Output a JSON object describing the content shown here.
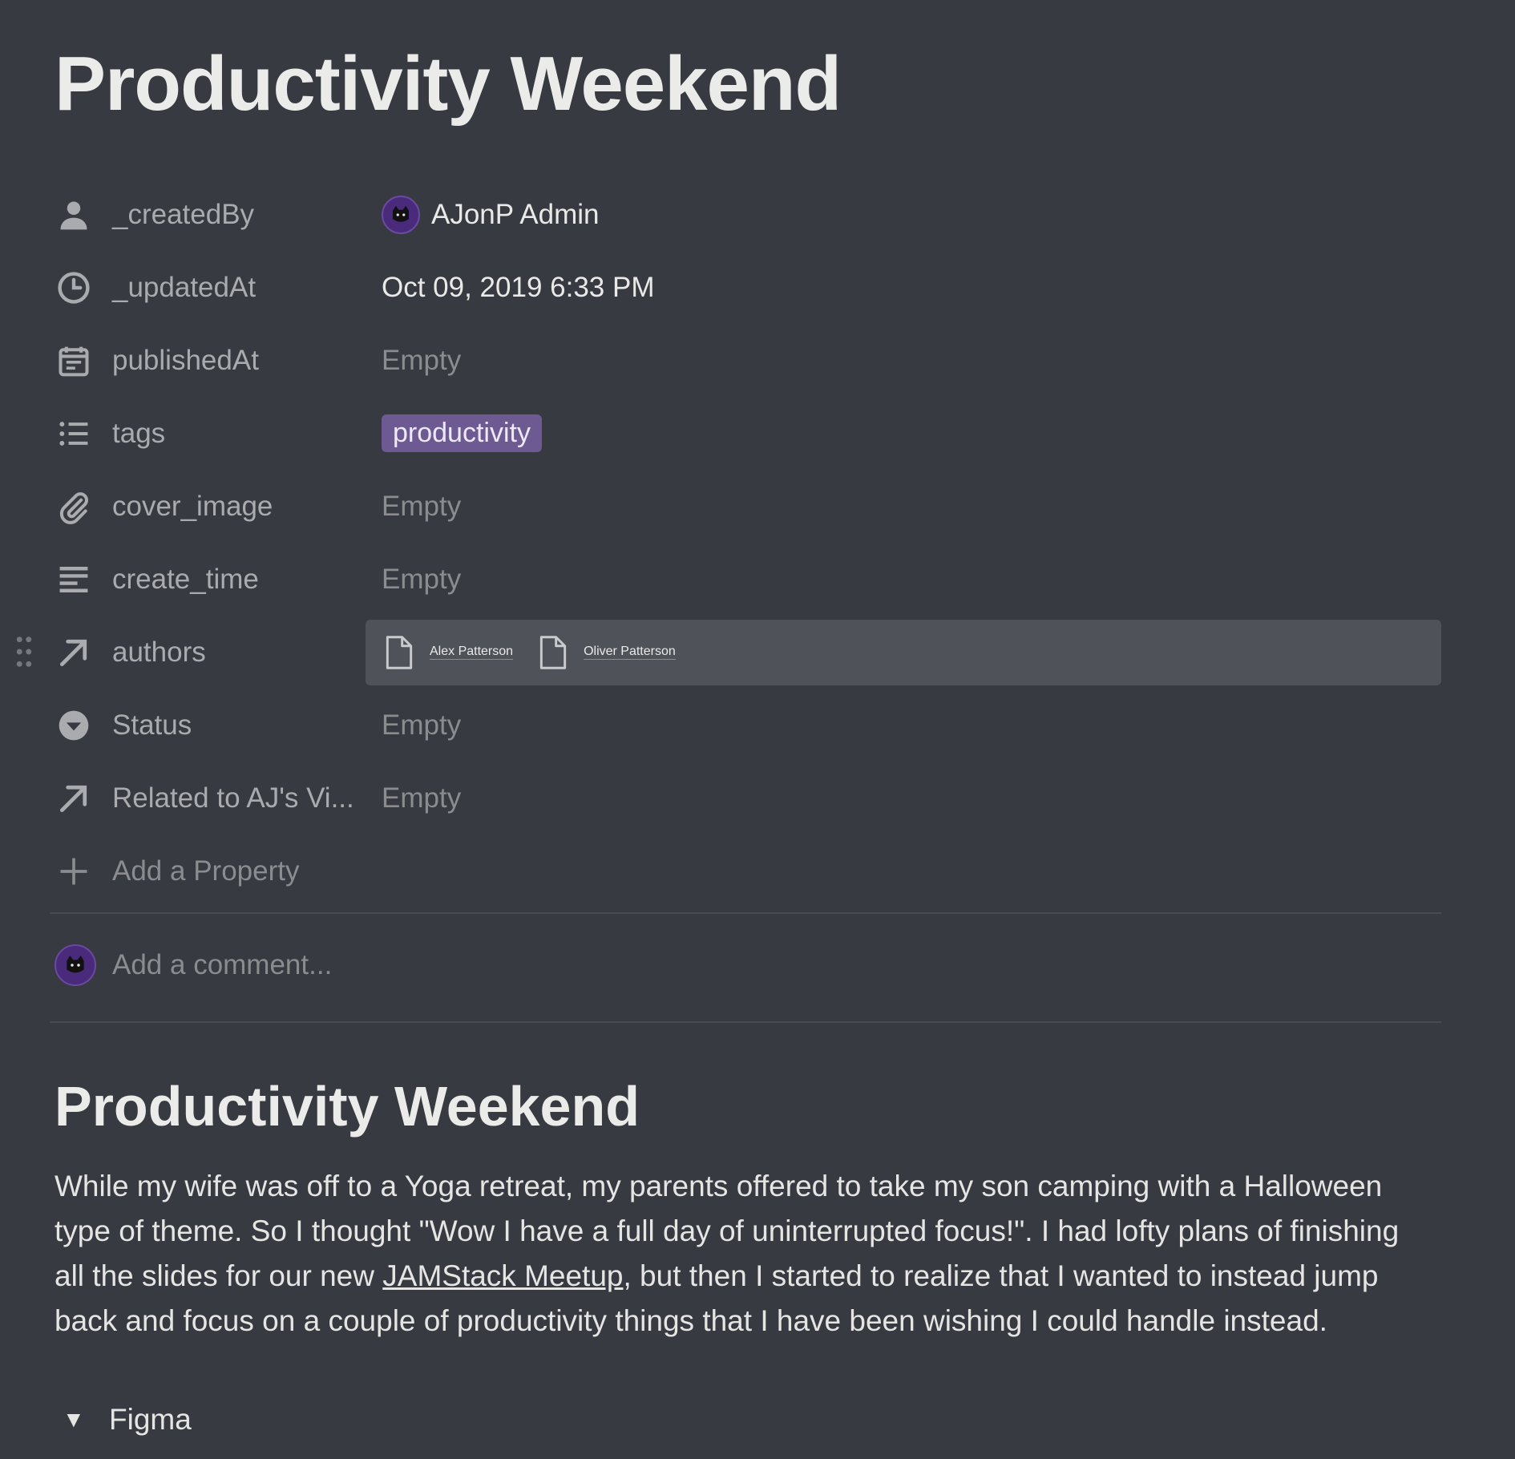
{
  "page": {
    "title": "Productivity Weekend"
  },
  "properties": [
    {
      "icon": "person-icon",
      "name": "_createdBy",
      "value": "AJonP Admin",
      "kind": "user"
    },
    {
      "icon": "clock-icon",
      "name": "_updatedAt",
      "value": "Oct 09, 2019 6:33 PM",
      "kind": "text"
    },
    {
      "icon": "calendar-icon",
      "name": "publishedAt",
      "value": "Empty",
      "kind": "empty"
    },
    {
      "icon": "list-icon",
      "name": "tags",
      "value": "productivity",
      "kind": "tag"
    },
    {
      "icon": "paperclip-icon",
      "name": "cover_image",
      "value": "Empty",
      "kind": "empty"
    },
    {
      "icon": "text-lines-icon",
      "name": "create_time",
      "value": "Empty",
      "kind": "empty"
    },
    {
      "icon": "arrow-up-right-icon",
      "name": "authors",
      "kind": "relation",
      "values": [
        "Alex Patterson",
        "Oliver Patterson"
      ]
    },
    {
      "icon": "chevron-circle-icon",
      "name": "Status",
      "value": "Empty",
      "kind": "empty"
    },
    {
      "icon": "arrow-up-right-icon",
      "name": "Related to AJ's Vi...",
      "value": "Empty",
      "kind": "empty"
    }
  ],
  "add_property_label": "Add a Property",
  "comment": {
    "placeholder": "Add a comment..."
  },
  "content": {
    "heading": "Productivity Weekend",
    "paragraph_before_link": "While my wife was off to a Yoga retreat, my parents offered to take my son camping with a Halloween type of theme. So I thought \"Wow I have a full day of uninterrupted focus!\". I had lofty plans of finishing all the slides for our new ",
    "link_text": "JAMStack Meetup",
    "paragraph_after_link": ", but then I started to realize that I wanted to instead jump back and focus on a couple of productivity things that I have been wishing I could handle instead.",
    "toggle_label": "Figma"
  },
  "colors": {
    "background": "#373a40",
    "tag": "#6d5a93",
    "highlight_row": "#4f5258"
  }
}
